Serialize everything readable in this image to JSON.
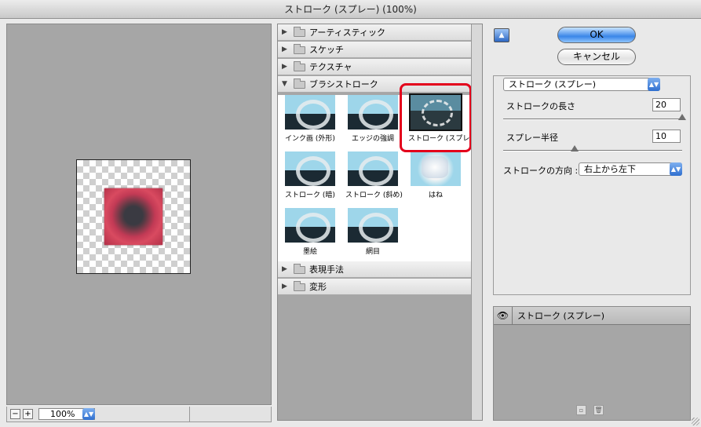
{
  "window": {
    "title": "ストローク (スプレー) (100%)"
  },
  "preview": {
    "zoom_value": "100%",
    "zoom_out": "−",
    "zoom_in": "+"
  },
  "gallery": {
    "categories_top": [
      {
        "label": "アーティスティック",
        "expanded": false
      },
      {
        "label": "スケッチ",
        "expanded": false
      },
      {
        "label": "テクスチャ",
        "expanded": false
      },
      {
        "label": "ブラシストローク",
        "expanded": true
      }
    ],
    "thumbnails": [
      {
        "label": "インク画 (外形)"
      },
      {
        "label": "エッジの強調"
      },
      {
        "label": "ストローク (スプレー)",
        "selected": true
      },
      {
        "label": "ストローク (暗)"
      },
      {
        "label": "ストローク (斜め)"
      },
      {
        "label": "はね"
      },
      {
        "label": "墨絵"
      },
      {
        "label": "網目"
      }
    ],
    "categories_bottom": [
      {
        "label": "表現手法",
        "expanded": false
      },
      {
        "label": "変形",
        "expanded": false
      }
    ]
  },
  "buttons": {
    "ok": "OK",
    "cancel": "キャンセル",
    "collapse_glyph": "▲"
  },
  "params": {
    "filter_select": "ストローク (スプレー)",
    "stroke_length_label": "ストロークの長さ",
    "stroke_length_value": "20",
    "stroke_length_max": 20,
    "spray_radius_label": "スプレー半径",
    "spray_radius_value": "10",
    "spray_radius_max": 25,
    "direction_label": "ストロークの方向 :",
    "direction_value": "右上から左下"
  },
  "layers": {
    "items": [
      {
        "name": "ストローク (スプレー)",
        "visible": true
      }
    ]
  }
}
